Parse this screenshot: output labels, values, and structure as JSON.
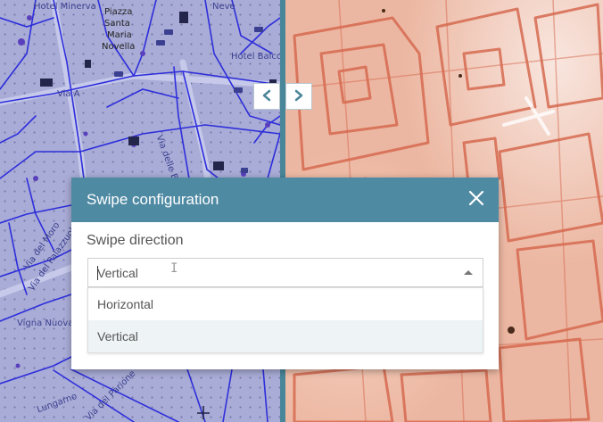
{
  "map_left": {
    "labels": {
      "hotel_minerva": "Hotel Minerva",
      "piazza": "Piazza",
      "santa": "Santa",
      "maria": "Maria",
      "novella": "Novella",
      "neve": "Neve",
      "hotel_balco": "Hotel Balco",
      "via_delle_belle": "Via delle Belle",
      "via_del_moro": "Via del Moro",
      "via_del_palazzuolo": "Via del Palazzuolo",
      "vigna_nuova": "Vigna Nuova",
      "via_del_parione": "Via del Parione",
      "lungarno": "Lungarno",
      "via_a": "Via A"
    }
  },
  "swipe": {
    "left_label": "‹",
    "right_label": "›",
    "icon_left": "chevron-left-icon",
    "icon_right": "chevron-right-icon"
  },
  "dialog": {
    "title": "Swipe configuration",
    "close_icon": "close-icon",
    "field_label": "Swipe direction",
    "select_value": "Vertical",
    "options": [
      "Horizontal",
      "Vertical"
    ],
    "selected_option": "Vertical"
  },
  "colors": {
    "header": "#4f8aa3",
    "divider": "#4a8699",
    "map_left_bg": "#a9acd6",
    "road": "#2e2edb",
    "map_right_bg": "#ecb7a2",
    "map_right_lines": "#d66a50"
  }
}
